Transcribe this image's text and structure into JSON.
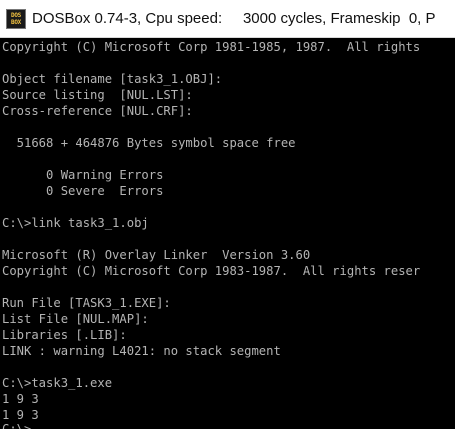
{
  "window": {
    "icon_label_top": "DOS",
    "icon_label_bottom": "BOX",
    "title": "DOSBox 0.74-3, Cpu speed:     3000 cycles, Frameskip  0, P"
  },
  "console": {
    "lines": [
      "Copyright (C) Microsoft Corp 1981-1985, 1987.  All rights",
      "",
      "Object filename [task3_1.OBJ]:",
      "Source listing  [NUL.LST]:",
      "Cross-reference [NUL.CRF]:",
      "",
      "  51668 + 464876 Bytes symbol space free",
      "",
      "      0 Warning Errors",
      "      0 Severe  Errors",
      "",
      "C:\\>link task3_1.obj",
      "",
      "Microsoft (R) Overlay Linker  Version 3.60",
      "Copyright (C) Microsoft Corp 1983-1987.  All rights reser",
      "",
      "Run File [TASK3_1.EXE]:",
      "List File [NUL.MAP]:",
      "Libraries [.LIB]:",
      "LINK : warning L4021: no stack segment",
      "",
      "C:\\>task3_1.exe",
      "1 9 3",
      "1 9 3",
      "C:\\>"
    ]
  },
  "colors": {
    "console_background": "#000000",
    "console_text": "#b4b4b4",
    "titlebar_background": "#ffffff"
  }
}
